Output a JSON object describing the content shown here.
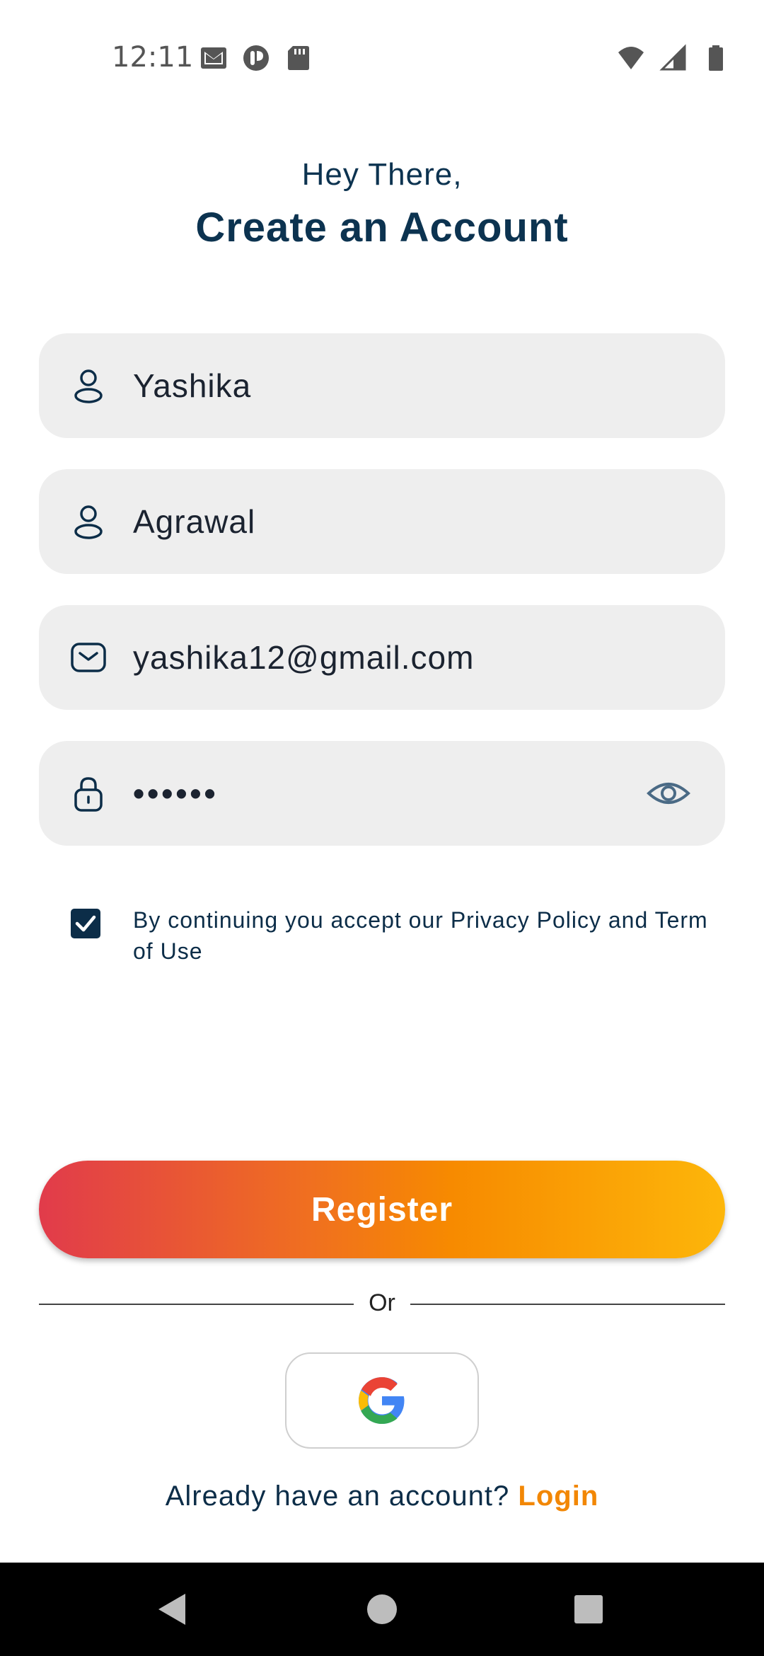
{
  "status_bar": {
    "time": "12:11",
    "left_icons": [
      "gmail-icon",
      "app-notification-icon",
      "sd-card-icon"
    ],
    "right_icons": [
      "wifi-icon",
      "cell-signal-icon",
      "battery-icon"
    ]
  },
  "header": {
    "greeting": "Hey There,",
    "title": "Create an Account"
  },
  "form": {
    "first_name": {
      "icon": "user-icon",
      "value": "Yashika"
    },
    "last_name": {
      "icon": "user-icon",
      "value": "Agrawal"
    },
    "email": {
      "icon": "mail-icon",
      "value": "yashika12@gmail.com"
    },
    "password": {
      "icon": "lock-icon",
      "value": "••••••",
      "toggle_icon": "eye-icon"
    }
  },
  "terms": {
    "checked": true,
    "text": "By continuing you accept our Privacy Policy and Term of Use"
  },
  "register": {
    "label": "Register"
  },
  "divider": {
    "label": "Or"
  },
  "social": {
    "google_icon": "google-icon"
  },
  "footer": {
    "prompt": "Already have an account?",
    "login_label": "Login"
  },
  "colors": {
    "primary_text": "#0c2d48",
    "accent": "#f28705",
    "gradient_start": "#e13b4b",
    "gradient_end": "#fdb60a",
    "field_bg": "#eeeeee"
  }
}
